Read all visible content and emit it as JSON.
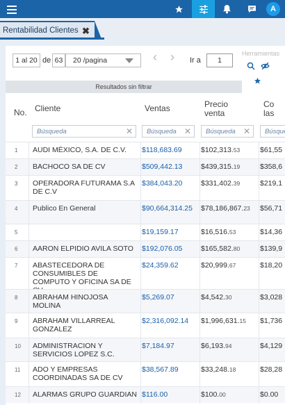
{
  "topbar": {
    "avatar_initial": "A"
  },
  "tab": {
    "title": "Rentabilidad Clientes",
    "close_glyph": "✖"
  },
  "pager": {
    "range": "1 al 20",
    "of_label": "de",
    "total": "63",
    "per_page": "20 /pagina",
    "goto_label": "Ir a",
    "goto_value": "1",
    "tools_label": "Herramientas"
  },
  "filter_status": "Resultados sin filtrar",
  "columns": {
    "no": "No.",
    "cliente": "Cliente",
    "ventas": "Ventas",
    "precio": "Precio venta",
    "costo": "Co las"
  },
  "filter_placeholder": "Búsqueda",
  "rows": [
    {
      "no": "1",
      "cliente": "AUDI MÉXICO, S.A. DE C.V.",
      "ventas": "$118,683.69",
      "precio_int": "$102,313.",
      "precio_dec": "53",
      "costo": "$61,55"
    },
    {
      "no": "2",
      "cliente": "BACHOCO SA DE CV",
      "ventas": "$509,442.13",
      "precio_int": "$439,315.",
      "precio_dec": "19",
      "costo": "$358,6"
    },
    {
      "no": "3",
      "cliente": "OPERADORA FUTURAMA S.A DE C.V",
      "ventas": "$384,043.20",
      "precio_int": "$331,402.",
      "precio_dec": "39",
      "costo": "$219,1"
    },
    {
      "no": "4",
      "cliente": "Publico En General",
      "ventas": "$90,664,314.25",
      "precio_int": "$78,186,867.",
      "precio_dec": "23",
      "costo": "$56,71"
    },
    {
      "no": "5",
      "cliente": "",
      "ventas": "$19,159.17",
      "precio_int": "$16,516.",
      "precio_dec": "53",
      "costo": "$14,36"
    },
    {
      "no": "6",
      "cliente": "AARON ELPIDIO AVILA SOTO",
      "ventas": "$192,076.05",
      "precio_int": "$165,582.",
      "precio_dec": "80",
      "costo": "$139,9"
    },
    {
      "no": "7",
      "cliente": "ABASTECEDORA DE CONSUMIBLES DE COMPUTO Y OFICINA SA DE CV",
      "ventas": "$24,359.62",
      "precio_int": "$20,999.",
      "precio_dec": "67",
      "costo": "$18,20"
    },
    {
      "no": "8",
      "cliente": "ABRAHAM HINOJOSA MOLINA",
      "ventas": "$5,269.07",
      "precio_int": "$4,542.",
      "precio_dec": "30",
      "costo": "$3,028"
    },
    {
      "no": "9",
      "cliente": "ABRAHAM VILLARREAL GONZALEZ",
      "ventas": "$2,316,092.14",
      "precio_int": "$1,996,631.",
      "precio_dec": "15",
      "costo": "$1,736"
    },
    {
      "no": "10",
      "cliente": "ADMINISTRACION Y SERVICIOS LOPEZ S.C.",
      "ventas": "$7,184.97",
      "precio_int": "$6,193.",
      "precio_dec": "94",
      "costo": "$4,129"
    },
    {
      "no": "11",
      "cliente": "ADO Y EMPRESAS COORDINADAS SA DE CV",
      "ventas": "$38,567.89",
      "precio_int": "$33,248.",
      "precio_dec": "18",
      "costo": "$28,28"
    },
    {
      "no": "12",
      "cliente": "ALARMAS GRUPO GUARDIAN",
      "ventas": "$116.00",
      "precio_int": "$100.",
      "precio_dec": "00",
      "costo": "$0.00"
    }
  ]
}
